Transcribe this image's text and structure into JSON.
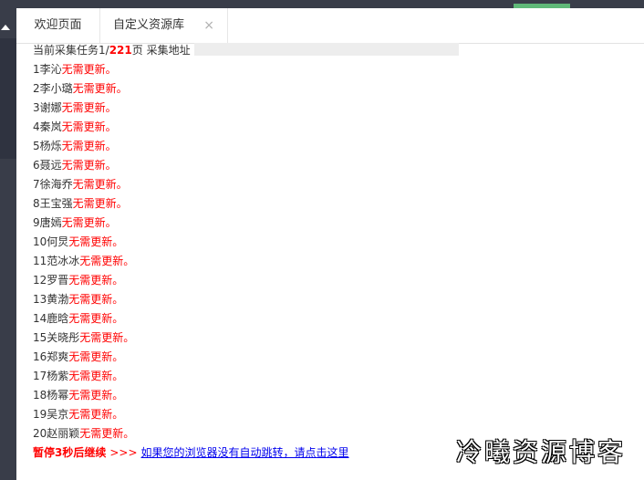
{
  "tabs": [
    {
      "label": "欢迎页面"
    },
    {
      "label": "自定义资源库"
    }
  ],
  "tab_close_glyph": "×",
  "status": {
    "prefix": "当前采集任务1/",
    "total": "221",
    "suffix": "页 采集地址"
  },
  "rows": [
    {
      "name": "1李沁",
      "status": "无需更新。"
    },
    {
      "name": "2李小璐",
      "status": "无需更新。"
    },
    {
      "name": "3谢娜",
      "status": "无需更新。"
    },
    {
      "name": "4秦岚",
      "status": "无需更新。"
    },
    {
      "name": "5杨烁",
      "status": "无需更新。"
    },
    {
      "name": "6聂远",
      "status": "无需更新。"
    },
    {
      "name": "7徐海乔",
      "status": "无需更新。"
    },
    {
      "name": "8王宝强",
      "status": "无需更新。"
    },
    {
      "name": "9唐嫣",
      "status": "无需更新。"
    },
    {
      "name": "10何炅",
      "status": "无需更新。"
    },
    {
      "name": "11范冰冰",
      "status": "无需更新。"
    },
    {
      "name": "12罗晋",
      "status": "无需更新。"
    },
    {
      "name": "13黄渤",
      "status": "无需更新。"
    },
    {
      "name": "14鹿晗",
      "status": "无需更新。"
    },
    {
      "name": "15关晓彤",
      "status": "无需更新。"
    },
    {
      "name": "16郑爽",
      "status": "无需更新。"
    },
    {
      "name": "17杨紫",
      "status": "无需更新。"
    },
    {
      "name": "18杨幂",
      "status": "无需更新。"
    },
    {
      "name": "19吴京",
      "status": "无需更新。"
    },
    {
      "name": "20赵丽颖",
      "status": "无需更新。"
    }
  ],
  "footer": {
    "pause": "暂停3秒后继续",
    "arrows": ">>>",
    "link": "如果您的浏览器没有自动跳转，请点击这里"
  },
  "watermark": "冷曦资源博客"
}
